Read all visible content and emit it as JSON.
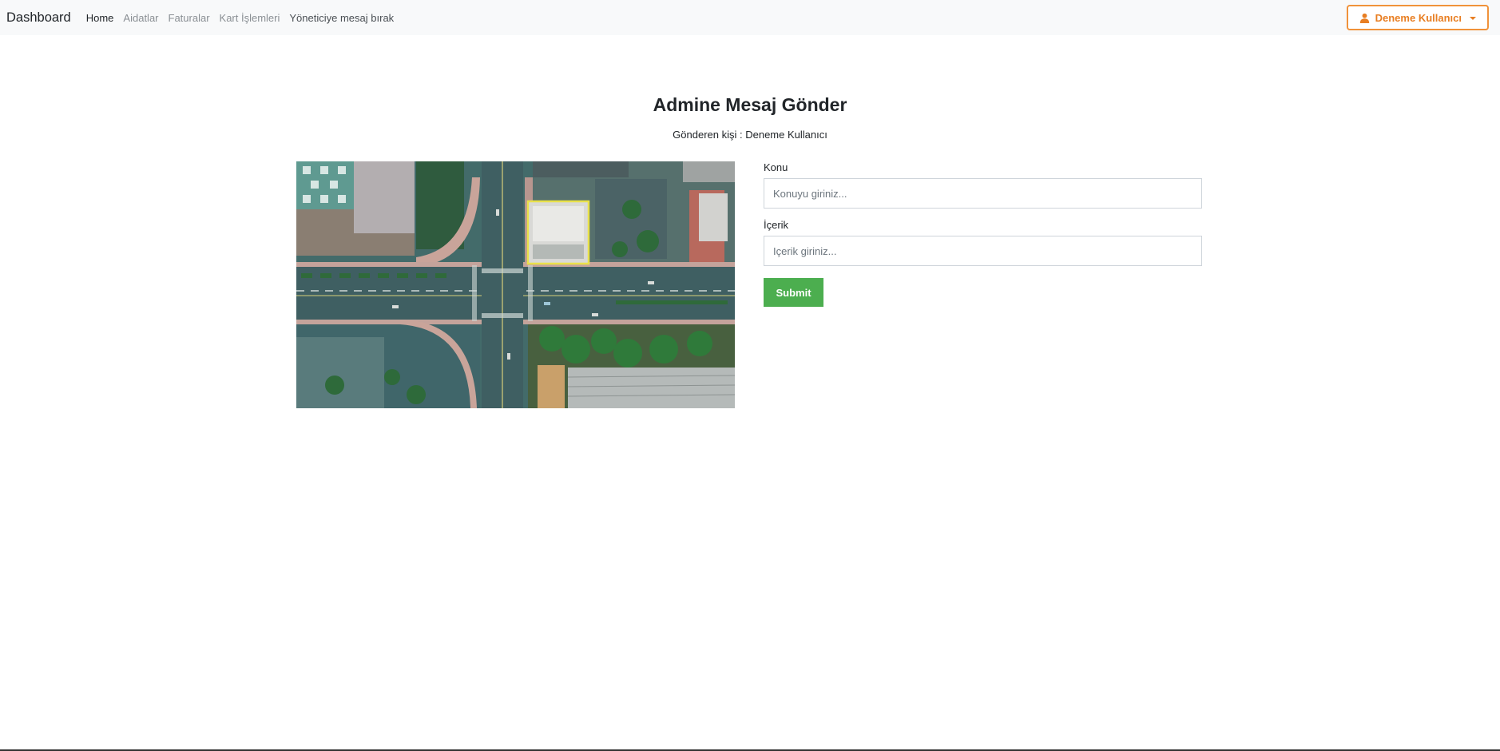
{
  "navbar": {
    "brand": "Dashboard",
    "links": [
      {
        "label": "Home"
      },
      {
        "label": "Aidatlar"
      },
      {
        "label": "Faturalar"
      },
      {
        "label": "Kart İşlemleri"
      },
      {
        "label": "Yöneticiye mesaj bırak"
      }
    ],
    "user_menu": {
      "label": "Deneme Kullanıcı",
      "icon": "user-icon",
      "color": "#e87e22"
    }
  },
  "page": {
    "title": "Admine Mesaj Gönder",
    "sender": "Gönderen kişi : Deneme Kullanıcı"
  },
  "form": {
    "subject_label": "Konu",
    "subject_placeholder": "Konuyu giriniz...",
    "content_label": "İçerik",
    "content_placeholder": "Içerik giriniz...",
    "submit_label": "Submit",
    "submit_color": "#4cae4f"
  }
}
